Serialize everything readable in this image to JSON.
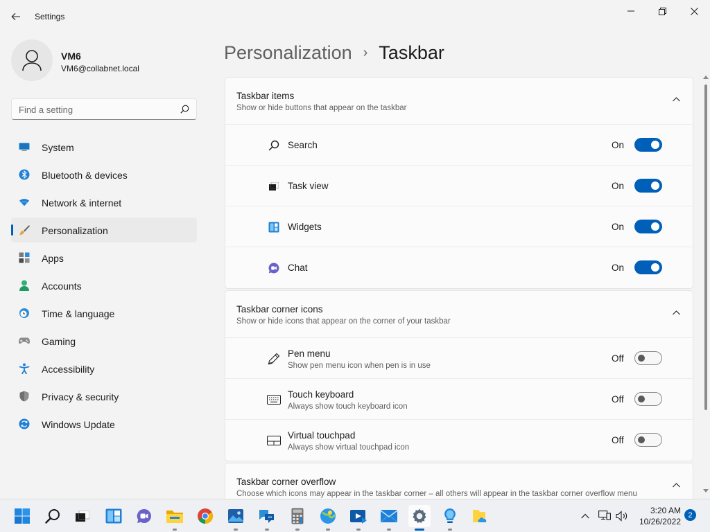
{
  "window": {
    "title": "Settings"
  },
  "profile": {
    "name": "VM6",
    "email": "VM6@collabnet.local"
  },
  "search": {
    "placeholder": "Find a setting"
  },
  "nav": {
    "items": [
      {
        "label": "System",
        "icon": "monitor-icon"
      },
      {
        "label": "Bluetooth & devices",
        "icon": "bluetooth-icon"
      },
      {
        "label": "Network & internet",
        "icon": "wifi-icon"
      },
      {
        "label": "Personalization",
        "icon": "brush-icon",
        "active": true
      },
      {
        "label": "Apps",
        "icon": "apps-icon"
      },
      {
        "label": "Accounts",
        "icon": "person-icon"
      },
      {
        "label": "Time & language",
        "icon": "clock-globe-icon"
      },
      {
        "label": "Gaming",
        "icon": "gamepad-icon"
      },
      {
        "label": "Accessibility",
        "icon": "accessibility-icon"
      },
      {
        "label": "Privacy & security",
        "icon": "shield-icon"
      },
      {
        "label": "Windows Update",
        "icon": "update-icon"
      }
    ]
  },
  "breadcrumb": {
    "parent": "Personalization",
    "separator": "›",
    "current": "Taskbar"
  },
  "sections": {
    "taskbar_items": {
      "title": "Taskbar items",
      "subtitle": "Show or hide buttons that appear on the taskbar",
      "rows": [
        {
          "label": "Search",
          "state": "On",
          "icon": "search-icon"
        },
        {
          "label": "Task view",
          "state": "On",
          "icon": "task-view-icon"
        },
        {
          "label": "Widgets",
          "state": "On",
          "icon": "widgets-icon"
        },
        {
          "label": "Chat",
          "state": "On",
          "icon": "chat-icon"
        }
      ]
    },
    "corner_icons": {
      "title": "Taskbar corner icons",
      "subtitle": "Show or hide icons that appear on the corner of your taskbar",
      "rows": [
        {
          "label": "Pen menu",
          "desc": "Show pen menu icon when pen is in use",
          "state": "Off",
          "icon": "pen-icon"
        },
        {
          "label": "Touch keyboard",
          "desc": "Always show touch keyboard icon",
          "state": "Off",
          "icon": "keyboard-icon"
        },
        {
          "label": "Virtual touchpad",
          "desc": "Always show virtual touchpad icon",
          "state": "Off",
          "icon": "touchpad-icon"
        }
      ]
    },
    "corner_overflow": {
      "title": "Taskbar corner overflow",
      "subtitle": "Choose which icons may appear in the taskbar corner – all others will appear in the taskbar corner overflow menu"
    }
  },
  "taskbar": {
    "apps": [
      "start-icon",
      "search-icon",
      "task-view-icon",
      "widgets-icon",
      "chat-icon",
      "file-explorer-icon",
      "chrome-icon",
      "photos-icon",
      "teams-icon",
      "calculator-icon",
      "maps-icon",
      "media-player-icon",
      "mail-icon",
      "settings-icon",
      "tips-icon",
      "onedrive-folder-icon"
    ],
    "clock": {
      "time": "3:20 AM",
      "date": "10/26/2022"
    },
    "notification_count": "2"
  },
  "colors": {
    "accent": "#005fb8",
    "background": "#f3f3f3",
    "card": "#fbfbfb"
  }
}
